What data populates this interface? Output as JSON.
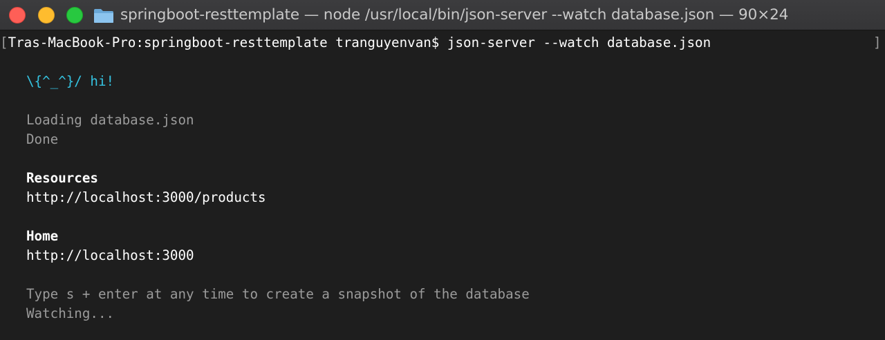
{
  "window": {
    "title": "springboot-resttemplate — node /usr/local/bin/json-server --watch database.json — 90×24",
    "traffic_lights": {
      "close_icon": "close-icon",
      "minimize_icon": "minimize-icon",
      "zoom_icon": "zoom-icon"
    },
    "folder_icon": "folder-icon",
    "colors": {
      "background": "#1e1e1e",
      "titlebar": "#3a3a3c",
      "cyan": "#35c3e1",
      "gray_text": "#9b9b9b",
      "white_text": "#ffffff"
    }
  },
  "terminal": {
    "prompt": "Tras-MacBook-Pro:springboot-resttemplate tranguyenvan$ json-server --watch database.json",
    "left_bracket": "[",
    "right_bracket": "]",
    "greeting": "\\{^_^}/ hi!",
    "loading": "Loading database.json",
    "done": "Done",
    "resources_heading": "Resources",
    "resources_url": "http://localhost:3000/products",
    "home_heading": "Home",
    "home_url": "http://localhost:3000",
    "hint": "Type s + enter at any time to create a snapshot of the database",
    "watching": "Watching..."
  }
}
